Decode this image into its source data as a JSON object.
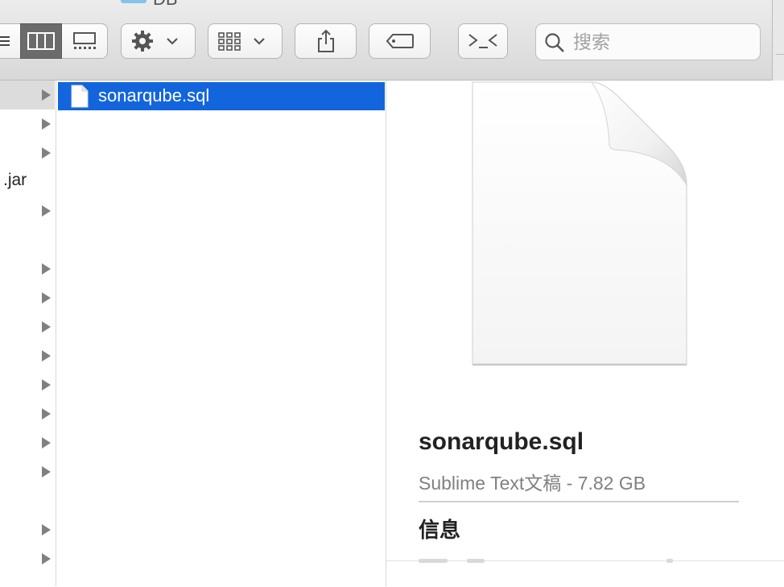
{
  "window": {
    "title_fragment": "DB"
  },
  "toolbar": {
    "view_modes": [
      {
        "name": "list",
        "icon": "list-view-icon",
        "selected": false
      },
      {
        "name": "columns",
        "icon": "columns-view-icon",
        "selected": true
      },
      {
        "name": "gallery",
        "icon": "gallery-view-icon",
        "selected": false
      }
    ],
    "action_icon": "gear-icon",
    "group_icon": "group-grid-icon",
    "share_icon": "share-icon",
    "tag_icon": "tag-icon",
    "terminal_icon": "terminal-icon",
    "search": {
      "placeholder": "搜索",
      "value": ""
    }
  },
  "column1": {
    "rows": [
      {
        "label": "",
        "has_children": true,
        "selected": true
      },
      {
        "label": "",
        "has_children": true
      },
      {
        "label": "",
        "has_children": true
      },
      {
        "label": ".jar",
        "has_children": false
      },
      {
        "label": "",
        "has_children": true
      },
      {
        "label": "",
        "has_children": false
      },
      {
        "label": "",
        "has_children": true
      },
      {
        "label": "",
        "has_children": true
      },
      {
        "label": "",
        "has_children": true
      },
      {
        "label": "",
        "has_children": true
      },
      {
        "label": "",
        "has_children": true
      },
      {
        "label": "",
        "has_children": true
      },
      {
        "label": "",
        "has_children": true
      },
      {
        "label": "",
        "has_children": true
      },
      {
        "label": "",
        "has_children": false
      },
      {
        "label": "",
        "has_children": true
      },
      {
        "label": "",
        "has_children": true
      }
    ]
  },
  "column2": {
    "items": [
      {
        "name": "sonarqube.sql",
        "selected": true
      }
    ]
  },
  "preview": {
    "filename": "sonarqube.sql",
    "kind_and_size": "Sublime Text文稿 - 7.82 GB",
    "section_info": "信息"
  },
  "colors": {
    "selection": "#1265dc",
    "toolbar_bg": "#e0e0e0",
    "selected_segment": "#6b6b6b"
  }
}
